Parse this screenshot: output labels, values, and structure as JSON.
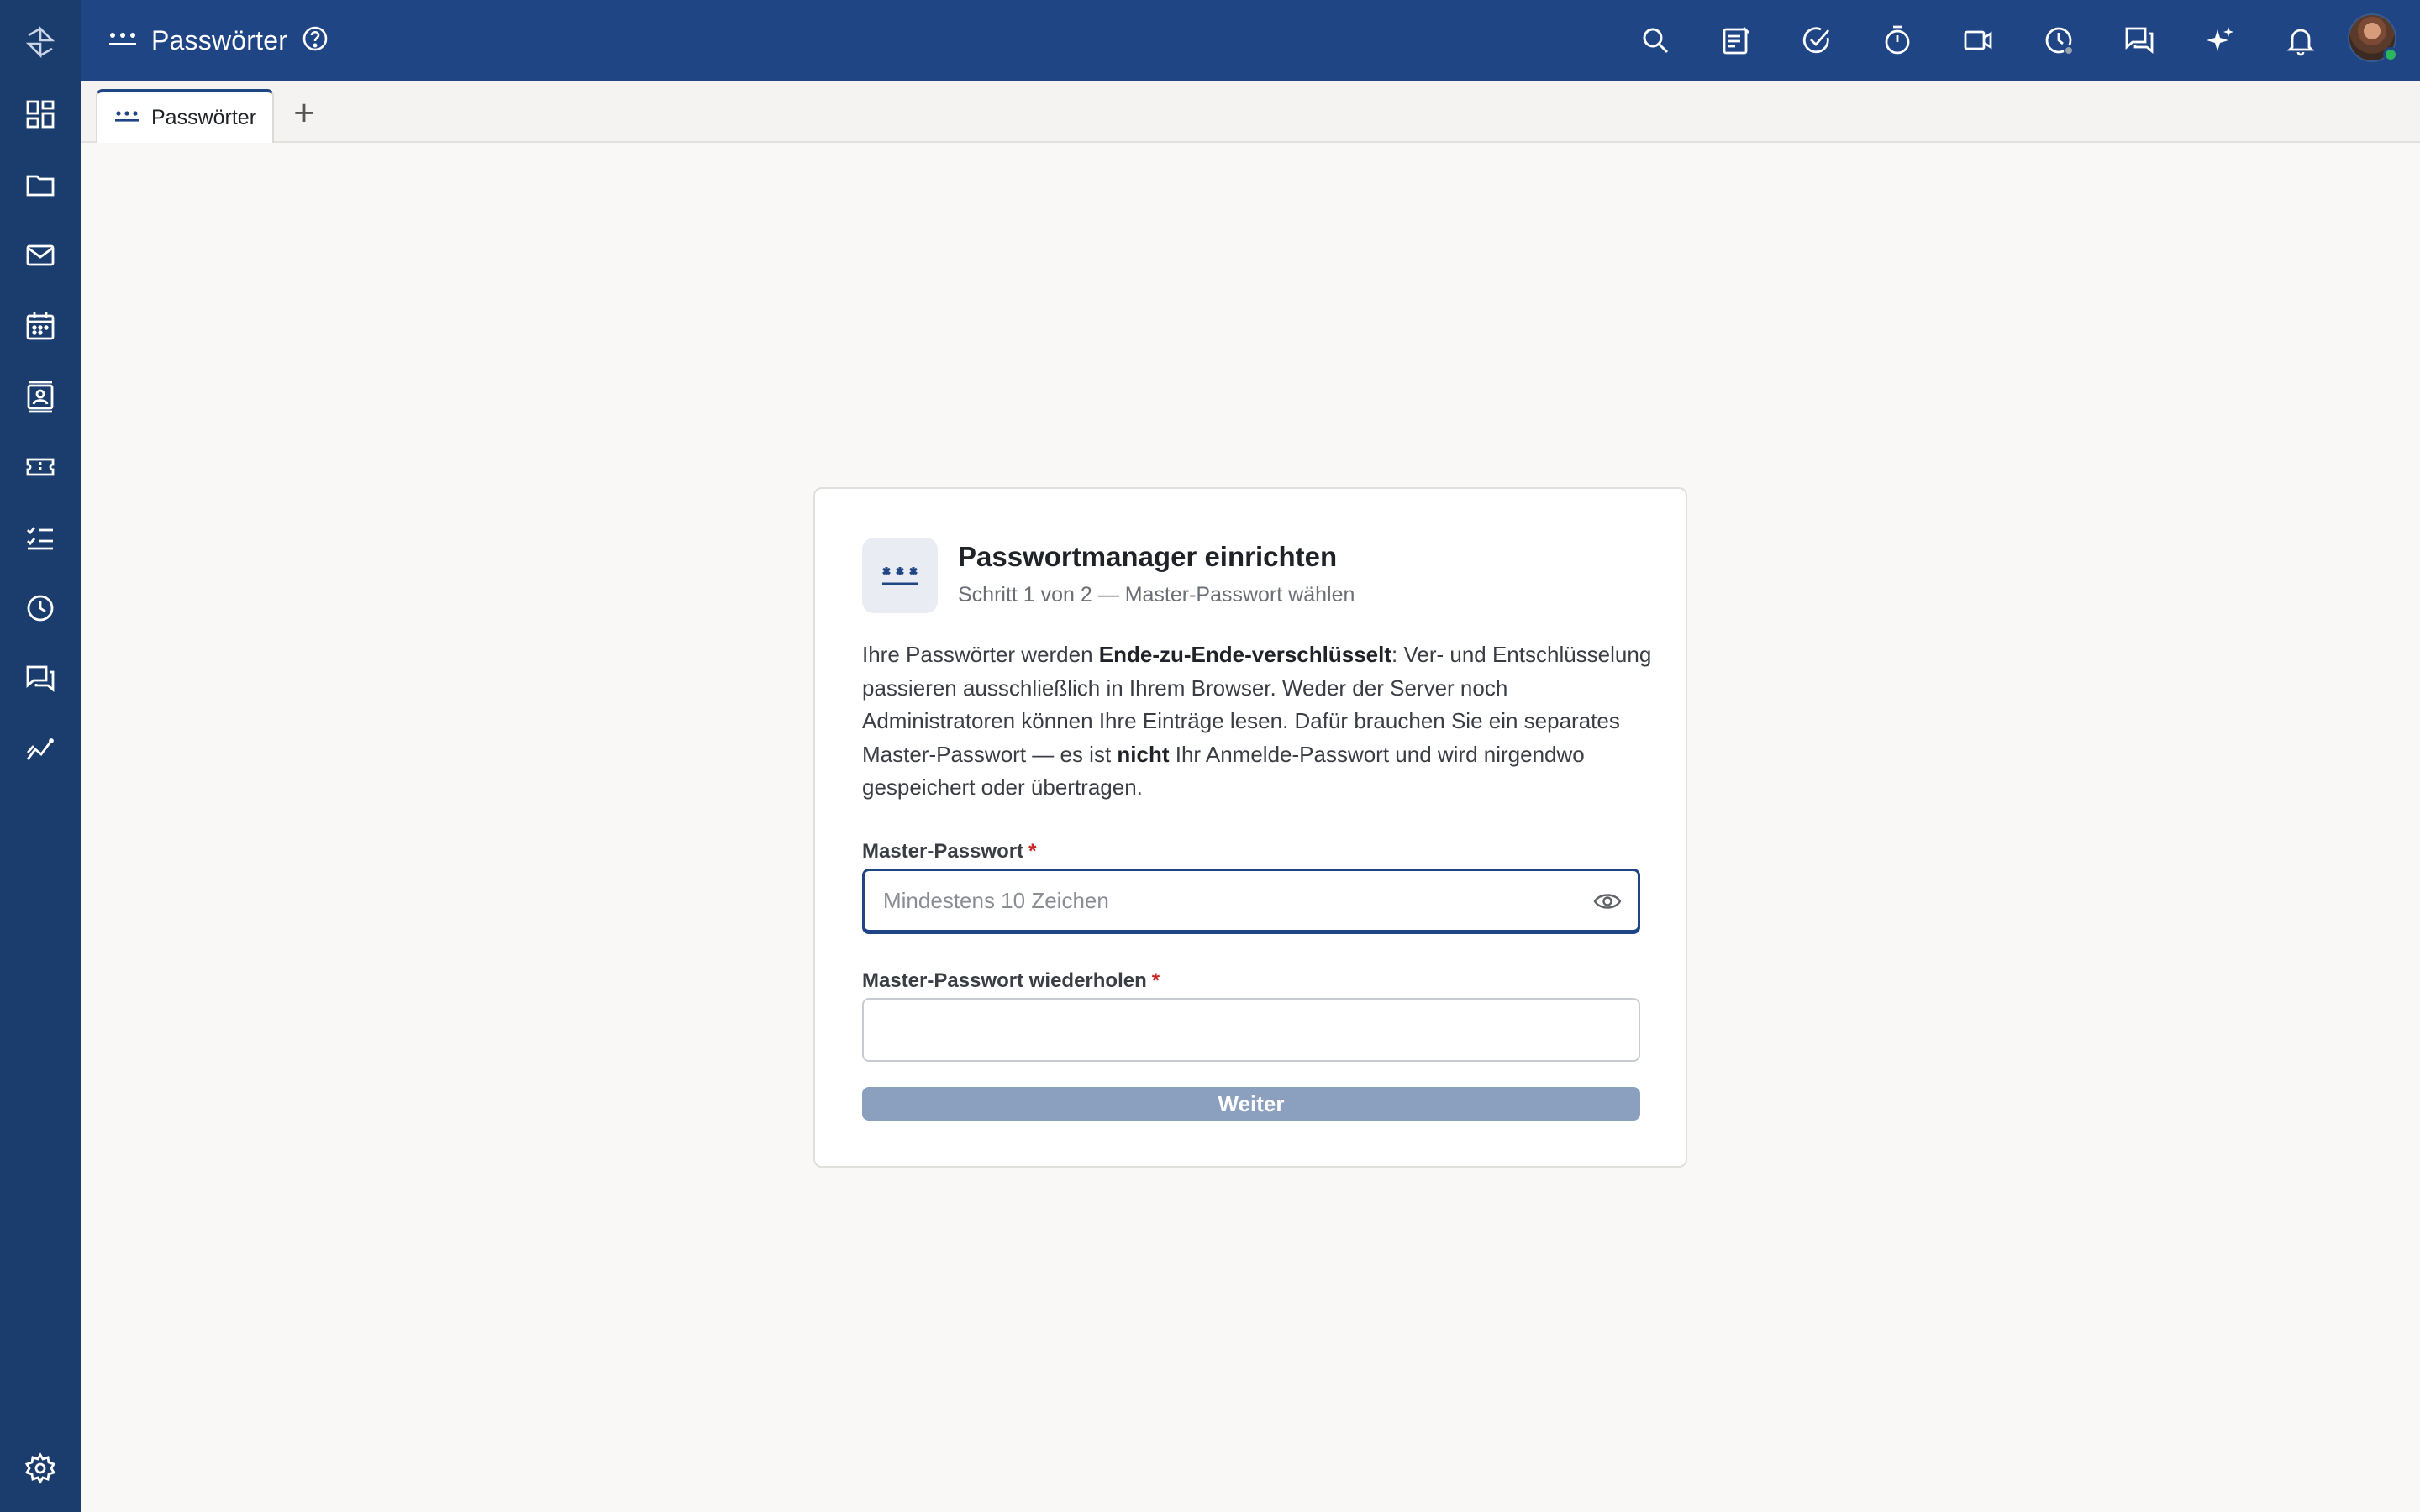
{
  "header": {
    "app_title": "Passwörter",
    "icons": [
      "search-icon",
      "notes-icon",
      "task-check-icon",
      "timer-icon",
      "video-icon",
      "history-icon",
      "chat-icon",
      "sparkle-icon",
      "bell-icon"
    ],
    "avatar_status": "online"
  },
  "sidebar": {
    "items": [
      "apps-icon",
      "folder-icon",
      "mail-icon",
      "calendar-icon",
      "contacts-icon",
      "ticket-icon",
      "tasks-icon",
      "clock-icon",
      "chat-icon",
      "analytics-icon"
    ],
    "settings": "gear-icon"
  },
  "tabs": {
    "active_label": "Passwörter",
    "add_label": "+"
  },
  "setup": {
    "title": "Passwortmanager einrichten",
    "subtitle": "Schritt 1 von 2 — Master-Passwort wählen",
    "desc_part1": "Ihre Passwörter werden ",
    "desc_bold1": "Ende-zu-Ende-verschlüsselt",
    "desc_part2": ": Ver- und Entschlüsselung passieren ausschließlich in Ihrem Browser. Weder der Server noch Administratoren können Ihre Einträge lesen. Dafür brauchen Sie ein separates Master-Passwort — es ist ",
    "desc_bold2": "nicht",
    "desc_part3": " Ihr Anmelde-Passwort und wird nirgendwo gespeichert oder übertragen.",
    "field1_label": "Master-Passwort",
    "field1_placeholder": "Mindestens 10 Zeichen",
    "field1_value": "",
    "field2_label": "Master-Passwort wiederholen",
    "field2_value": "",
    "required_mark": "*",
    "submit_label": "Weiter"
  },
  "colors": {
    "rail": "#1b3d6d",
    "topbar": "#1f4585",
    "accent": "#1f4585",
    "button_disabled": "#8b9fbf",
    "required": "#c62828"
  }
}
